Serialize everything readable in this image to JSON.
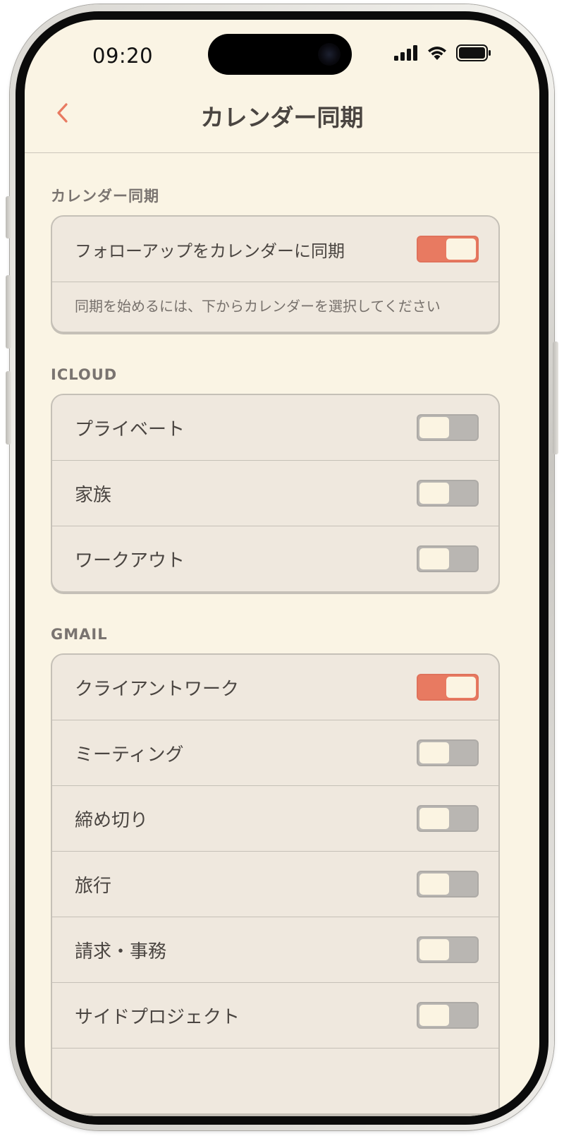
{
  "status_bar": {
    "time": "09:20",
    "icons": [
      "signal-icon",
      "wifi-icon",
      "battery-icon"
    ]
  },
  "header": {
    "title": "カレンダー同期",
    "back_icon": "chevron-left-icon"
  },
  "sections": {
    "sync": {
      "label": "カレンダー同期",
      "master_toggle": {
        "label": "フォローアップをカレンダーに同期",
        "on": true
      },
      "hint": "同期を始めるには、下からカレンダーを選択してください"
    },
    "icloud": {
      "label": "ICLOUD",
      "items": [
        {
          "label": "プライベート",
          "on": false
        },
        {
          "label": "家族",
          "on": false
        },
        {
          "label": "ワークアウト",
          "on": false
        }
      ]
    },
    "gmail": {
      "label": "GMAIL",
      "items": [
        {
          "label": "クライアントワーク",
          "on": true
        },
        {
          "label": "ミーティング",
          "on": false
        },
        {
          "label": "締め切り",
          "on": false
        },
        {
          "label": "旅行",
          "on": false
        },
        {
          "label": "請求・事務",
          "on": false
        },
        {
          "label": "サイドプロジェクト",
          "on": false
        }
      ]
    }
  },
  "colors": {
    "background": "#faf4e4",
    "card": "#efe8de",
    "accent": "#e87a61",
    "toggle_off": "#b9b6b2",
    "text": "#4a4541"
  }
}
